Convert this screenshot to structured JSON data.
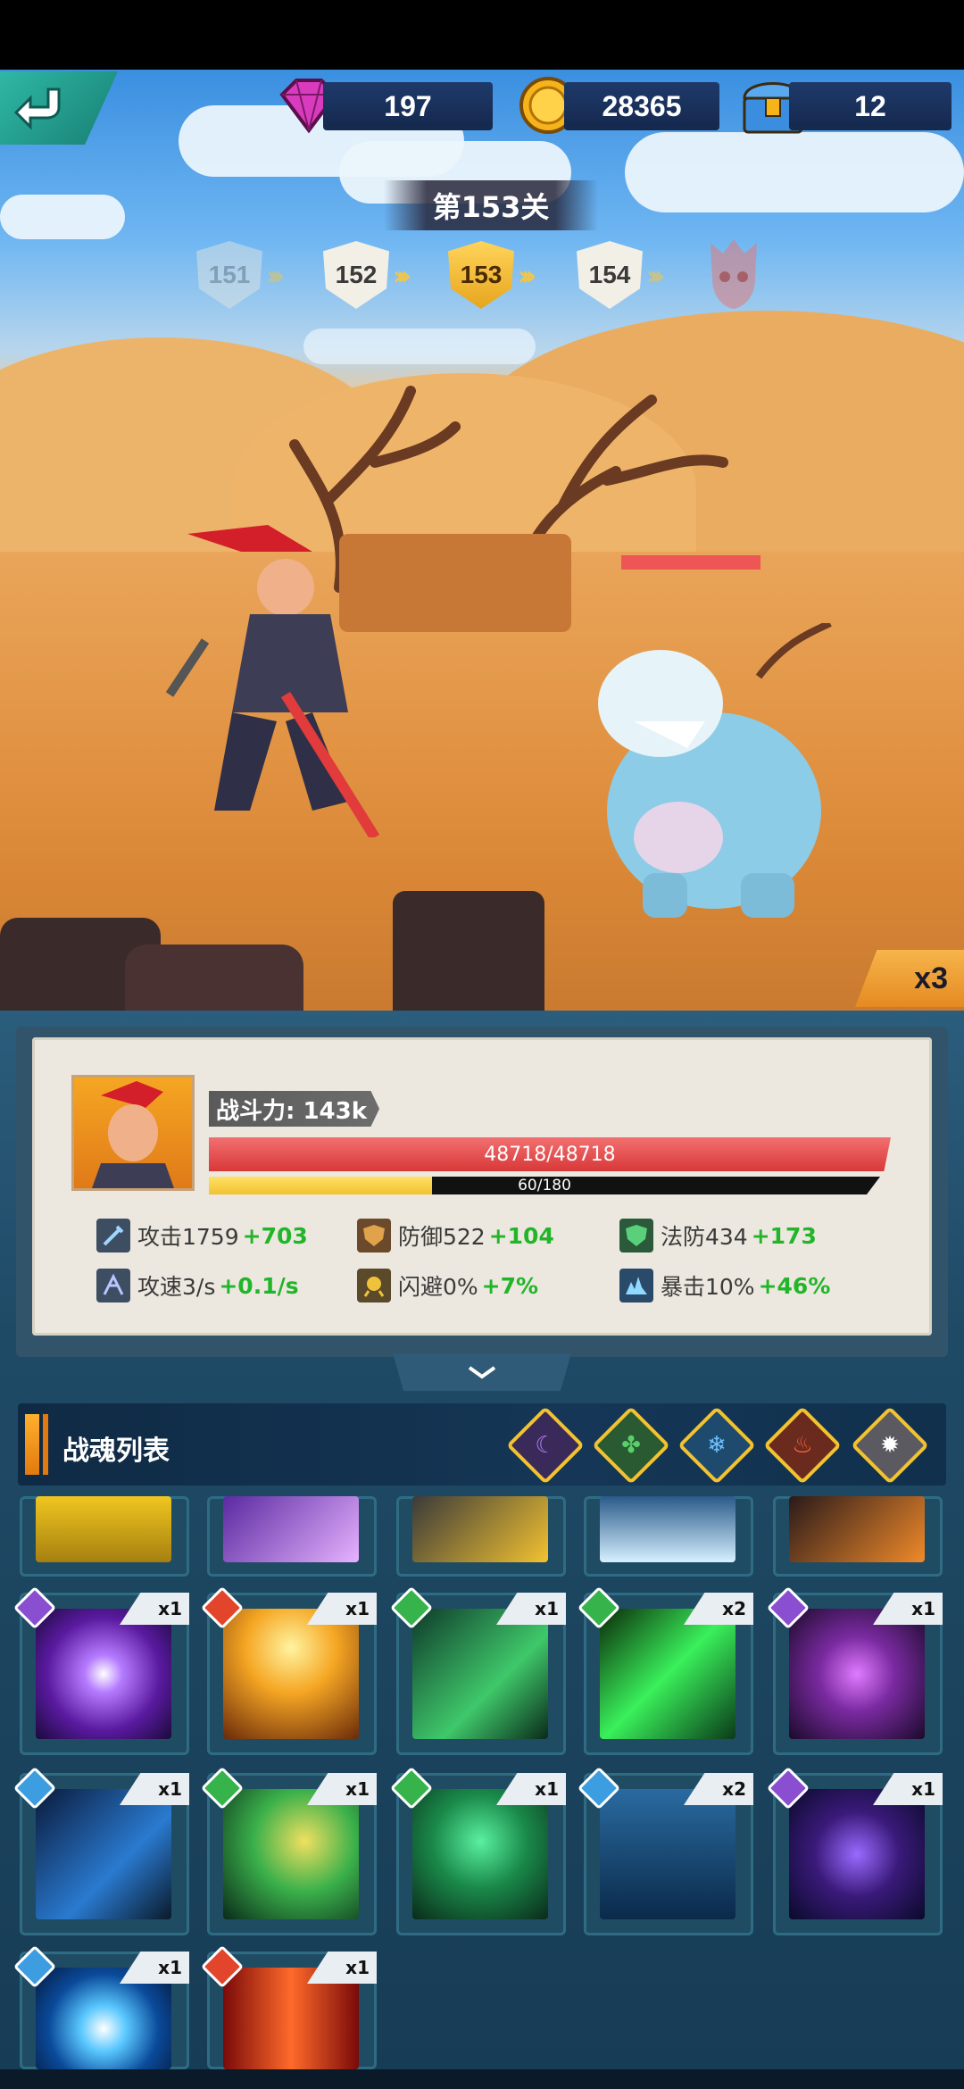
{
  "resources": {
    "gems": "197",
    "coins": "28365",
    "chests": "12"
  },
  "stage": {
    "title": "第153关",
    "levels": [
      "151",
      "152",
      "153",
      "154"
    ]
  },
  "speed": "x3",
  "hero": {
    "power_label": "战斗力: 143k",
    "hp_text": "48718/48718",
    "xp_text": "60/180",
    "xp_fraction": 0.333,
    "stats": [
      {
        "label": "攻击1759",
        "bonus": "+703",
        "icon": "sword-icon"
      },
      {
        "label": "防御522",
        "bonus": "+104",
        "icon": "shield-icon"
      },
      {
        "label": "法防434",
        "bonus": "+173",
        "icon": "magic-shield-icon"
      },
      {
        "label": "攻速3/s",
        "bonus": "+0.1/s",
        "icon": "attack-speed-icon"
      },
      {
        "label": "闪避0%",
        "bonus": "+7%",
        "icon": "dodge-icon"
      },
      {
        "label": "暴击10%",
        "bonus": "+46%",
        "icon": "crit-icon"
      }
    ]
  },
  "soul_list": {
    "title": "战魂列表",
    "filters": [
      {
        "name": "dark",
        "glyph": "☾",
        "color": "#8a4fd0"
      },
      {
        "name": "nature",
        "glyph": "✤",
        "color": "#36b34a"
      },
      {
        "name": "water",
        "glyph": "❄",
        "color": "#3c9ee0"
      },
      {
        "name": "fire",
        "glyph": "♨",
        "color": "#e2452b"
      },
      {
        "name": "light",
        "glyph": "✹",
        "color": "#d6d2c8"
      }
    ],
    "cards": [
      {
        "count": "x1",
        "element": "dark",
        "gem": "#8a4fd0"
      },
      {
        "count": "x1",
        "element": "fire",
        "gem": "#e2452b"
      },
      {
        "count": "x1",
        "element": "nature",
        "gem": "#36b34a"
      },
      {
        "count": "x2",
        "element": "nature",
        "gem": "#36b34a"
      },
      {
        "count": "x1",
        "element": "dark",
        "gem": "#8a4fd0"
      },
      {
        "count": "x1",
        "element": "water",
        "gem": "#3c9ee0"
      },
      {
        "count": "x1",
        "element": "nature",
        "gem": "#36b34a"
      },
      {
        "count": "x1",
        "element": "nature",
        "gem": "#36b34a"
      },
      {
        "count": "x2",
        "element": "water",
        "gem": "#3c9ee0"
      },
      {
        "count": "x1",
        "element": "dark",
        "gem": "#8a4fd0"
      },
      {
        "count": "x1",
        "element": "water",
        "gem": "#3c9ee0"
      },
      {
        "count": "x1",
        "element": "fire",
        "gem": "#e2452b"
      }
    ]
  }
}
